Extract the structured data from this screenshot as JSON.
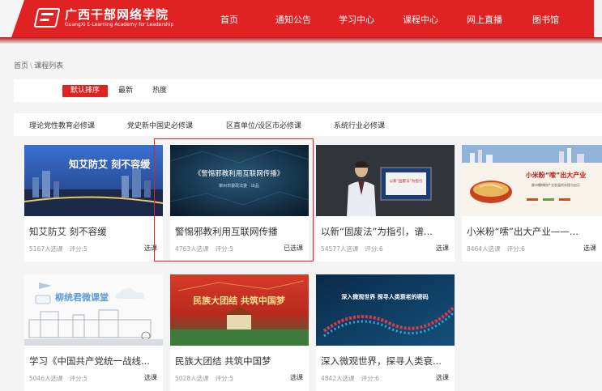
{
  "site": {
    "name": "广西干部网络学院",
    "subtitle": "GuangXi E-Learning Academy for Leadership"
  },
  "nav": {
    "items": [
      {
        "label": "首页"
      },
      {
        "label": "通知公告"
      },
      {
        "label": "学习中心"
      },
      {
        "label": "课程中心"
      },
      {
        "label": "网上直播"
      },
      {
        "label": "图书馆"
      }
    ]
  },
  "breadcrumb": {
    "home": "首页",
    "separator": "\\",
    "current": "课程列表"
  },
  "sort": {
    "items": [
      {
        "label": "默认排序",
        "active": true
      },
      {
        "label": "最新",
        "active": false
      },
      {
        "label": "热度",
        "active": false
      }
    ]
  },
  "categories": {
    "items": [
      {
        "label": "理论党性教育必修课"
      },
      {
        "label": "党史新中国史必修课"
      },
      {
        "label": "区直单位/设区市必修课"
      },
      {
        "label": "系统行业必修课"
      }
    ]
  },
  "courses": [
    {
      "title": "知艾防艾 刻不容缓",
      "enrolled": "5167人选课",
      "score": "评分:5",
      "action": "选课",
      "thumb_text": "知艾防艾  刻不容缓"
    },
    {
      "title": "警惕邪教利用互联网传播",
      "enrolled": "4763人选课",
      "score": "评分:5",
      "action": "已选课",
      "thumb_text": "《警惕邪教利用互联网传播》",
      "thumb_sub": "柳州市委政法委 · 出品"
    },
    {
      "title": "以新“固废法”为指引，谱...",
      "enrolled": "54577人选课",
      "score": "评分:6",
      "action": "选课",
      "thumb_text": "以新“固废法”为指引"
    },
    {
      "title": "小米粉“嗦”出大产业——...",
      "enrolled": "8464人选课",
      "score": "评分:6",
      "action": "选课",
      "thumb_text": "小米粉“嗦”出大产业",
      "thumb_sub": "柳州螺蛳粉产业发展的实践与启示"
    },
    {
      "title": "学习《中国共产党统一战线...",
      "enrolled": "5046人选课",
      "score": "评分:5",
      "action": "选课",
      "thumb_text": "柳统君微课堂"
    },
    {
      "title": "民族大团结 共筑中国梦",
      "enrolled": "5028人选课",
      "score": "评分:5",
      "action": "选课",
      "thumb_text": "民族大团结 共筑中国梦"
    },
    {
      "title": "深入微观世界，探寻人类衰...",
      "enrolled": "4842人选课",
      "score": "评分:6",
      "action": "选课",
      "thumb_text": "深入微观世界 探寻人类衰老的密码"
    }
  ],
  "colors": {
    "brand": "#e02222",
    "page_bg": "#f4f4f4",
    "muted": "#999999"
  }
}
